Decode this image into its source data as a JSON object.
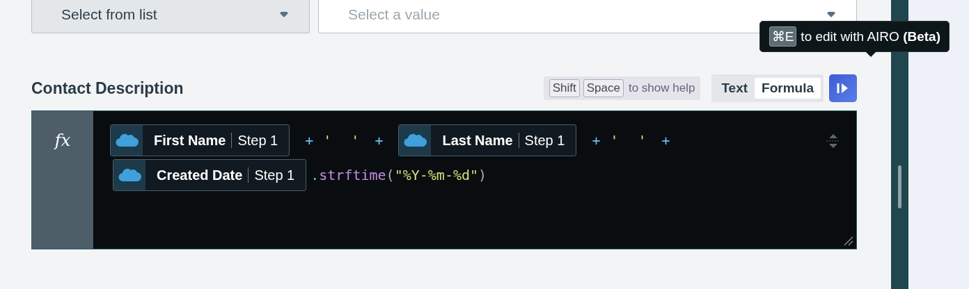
{
  "dropdowns": [
    {
      "value": "Select from list"
    },
    {
      "placeholder": "Select a value"
    }
  ],
  "field": {
    "label": "Contact Description"
  },
  "help": {
    "keys": [
      "Shift",
      "Space"
    ],
    "text": "to show help"
  },
  "mode_toggle": [
    {
      "label": "Text",
      "selected": false
    },
    {
      "label": "Formula",
      "selected": true
    }
  ],
  "tooltip": {
    "key": "⌘E",
    "text": "to edit with AIRO **(Beta)**"
  },
  "editor": {
    "gutter": "fx",
    "lines": [
      [
        {
          "kind": "chip",
          "label": "First Name",
          "step": "Step 1"
        },
        {
          "kind": "op",
          "text": "+"
        },
        {
          "kind": "str",
          "text": "' '"
        },
        {
          "kind": "op",
          "text": "+"
        },
        {
          "kind": "chip",
          "label": "Last Name",
          "step": "Step 1"
        },
        {
          "kind": "op",
          "text": "+"
        },
        {
          "kind": "str",
          "text": "' '"
        },
        {
          "kind": "op",
          "text": "+"
        }
      ],
      [
        {
          "kind": "chip",
          "label": "Created Date",
          "step": "Step 1"
        },
        {
          "kind": "dot",
          "text": "."
        },
        {
          "kind": "method",
          "text": "strftime"
        },
        {
          "kind": "punct",
          "text": "("
        },
        {
          "kind": "str",
          "text": "\"%Y-%m-%d\""
        },
        {
          "kind": "punct",
          "text": ")"
        }
      ]
    ]
  }
}
